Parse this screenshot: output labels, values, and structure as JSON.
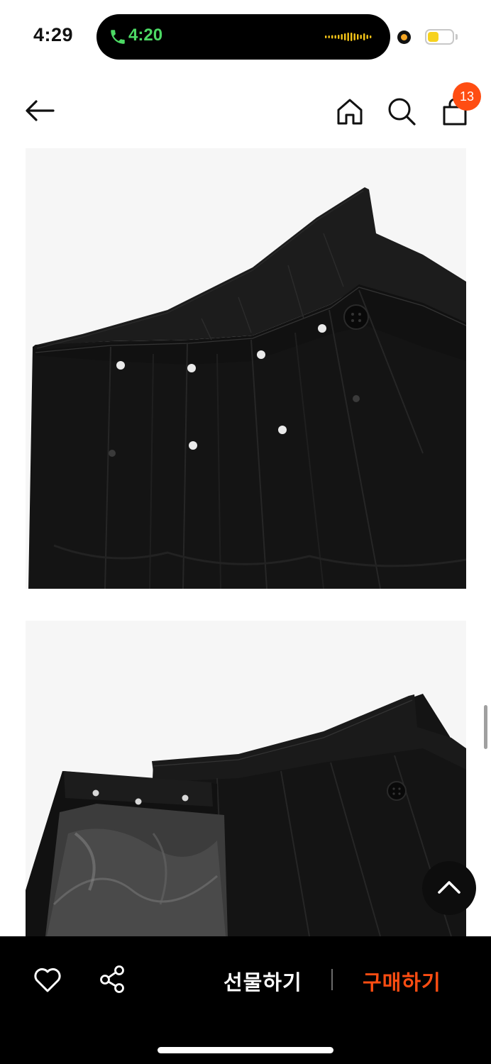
{
  "status_bar": {
    "time": "4:29",
    "call_time": "4:20",
    "battery_level": 0.45,
    "icons": [
      "phone-icon",
      "waveform-icon",
      "recording-dot-icon",
      "battery-icon"
    ],
    "colors": {
      "call_green": "#4cd964",
      "battery_yellow": "#f7d21e",
      "recording_orange": "#f5a623"
    }
  },
  "header": {
    "icons": [
      "back-arrow-icon",
      "home-icon",
      "search-icon",
      "shopping-bag-icon"
    ],
    "cart_count": "13",
    "badge_color": "#ff4d12"
  },
  "content": {
    "images": [
      {
        "subject": "black-asymmetric-pleated-skirt-waistband-front-detail"
      },
      {
        "subject": "black-pleated-skirt-open-lining-detail"
      }
    ]
  },
  "floating": {
    "icon": "chevron-up-icon"
  },
  "bottom_bar": {
    "icons": [
      "heart-icon",
      "share-icon"
    ],
    "gift_label": "선물하기",
    "buy_label": "구매하기",
    "accent_color": "#ff4d12"
  }
}
